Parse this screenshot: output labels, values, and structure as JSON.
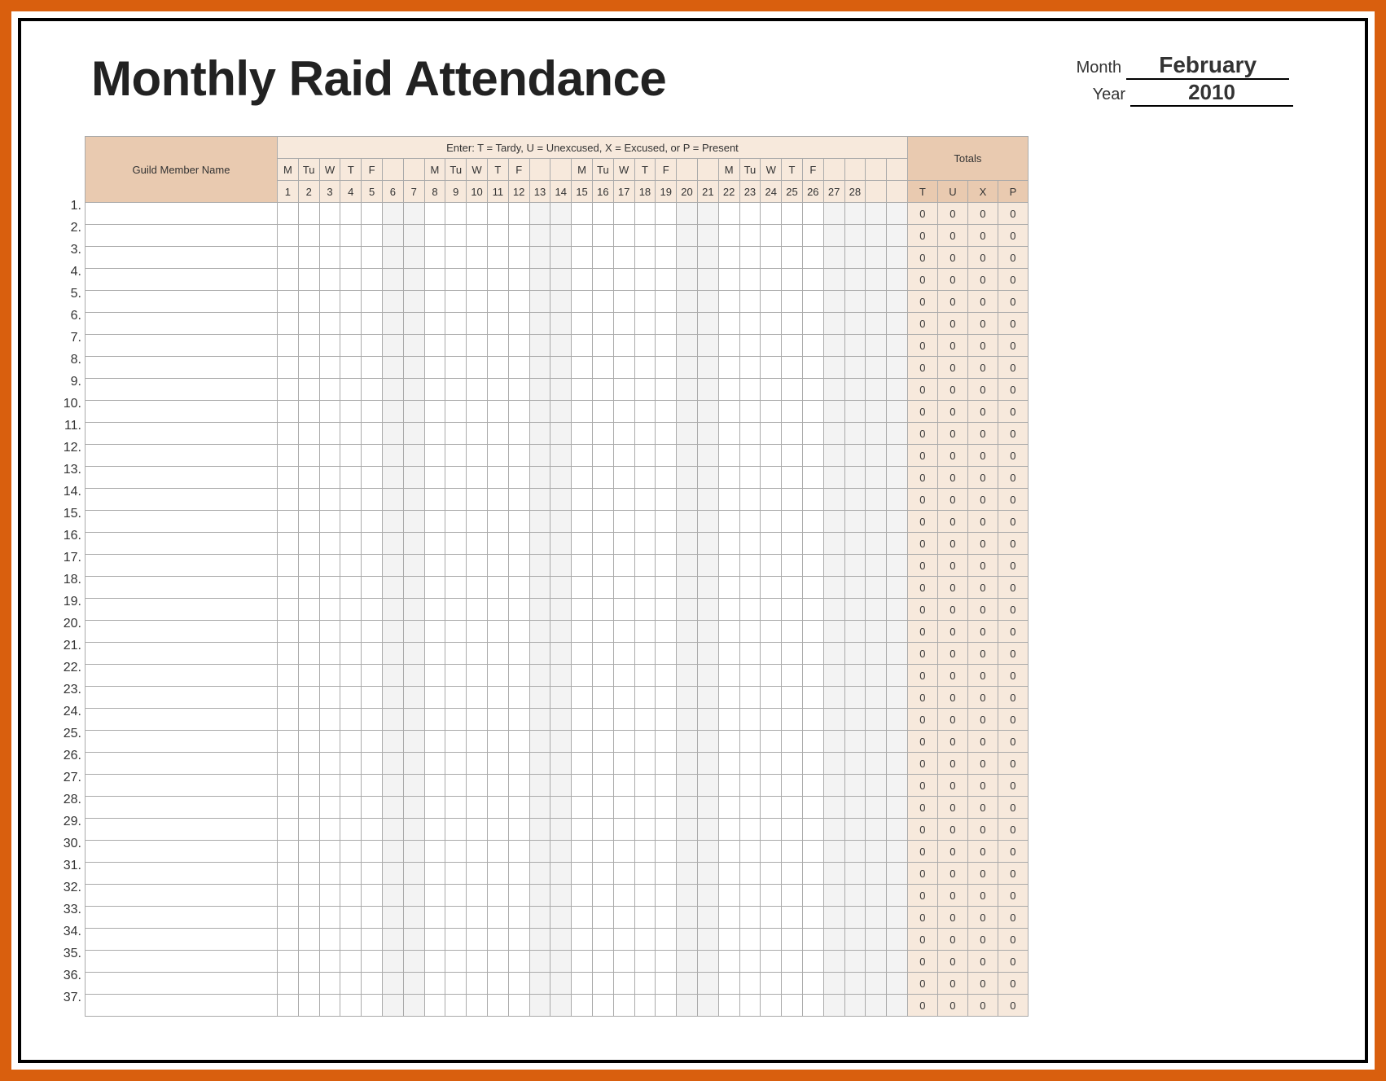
{
  "title": "Monthly Raid Attendance",
  "month_label": "Month",
  "year_label": "Year",
  "month_value": "February",
  "year_value": "2010",
  "legend": "Enter:  T = Tardy,   U = Unexcused,   X = Excused,   or P = Present",
  "name_header": "Guild Member Name",
  "totals_header": "Totals",
  "totals_cols": [
    "T",
    "U",
    "X",
    "P"
  ],
  "days": [
    {
      "n": 1,
      "dow": "M",
      "wk": false
    },
    {
      "n": 2,
      "dow": "Tu",
      "wk": false
    },
    {
      "n": 3,
      "dow": "W",
      "wk": false
    },
    {
      "n": 4,
      "dow": "T",
      "wk": false
    },
    {
      "n": 5,
      "dow": "F",
      "wk": false
    },
    {
      "n": 6,
      "dow": "",
      "wk": true
    },
    {
      "n": 7,
      "dow": "",
      "wk": true
    },
    {
      "n": 8,
      "dow": "M",
      "wk": false
    },
    {
      "n": 9,
      "dow": "Tu",
      "wk": false
    },
    {
      "n": 10,
      "dow": "W",
      "wk": false
    },
    {
      "n": 11,
      "dow": "T",
      "wk": false
    },
    {
      "n": 12,
      "dow": "F",
      "wk": false
    },
    {
      "n": 13,
      "dow": "",
      "wk": true
    },
    {
      "n": 14,
      "dow": "",
      "wk": true
    },
    {
      "n": 15,
      "dow": "M",
      "wk": false
    },
    {
      "n": 16,
      "dow": "Tu",
      "wk": false
    },
    {
      "n": 17,
      "dow": "W",
      "wk": false
    },
    {
      "n": 18,
      "dow": "T",
      "wk": false
    },
    {
      "n": 19,
      "dow": "F",
      "wk": false
    },
    {
      "n": 20,
      "dow": "",
      "wk": true
    },
    {
      "n": 21,
      "dow": "",
      "wk": true
    },
    {
      "n": 22,
      "dow": "M",
      "wk": false
    },
    {
      "n": 23,
      "dow": "Tu",
      "wk": false
    },
    {
      "n": 24,
      "dow": "W",
      "wk": false
    },
    {
      "n": 25,
      "dow": "T",
      "wk": false
    },
    {
      "n": 26,
      "dow": "F",
      "wk": false
    },
    {
      "n": 27,
      "dow": "",
      "wk": true
    },
    {
      "n": 28,
      "dow": "",
      "wk": true
    },
    {
      "n": "",
      "dow": "",
      "wk": true
    },
    {
      "n": "",
      "dow": "",
      "wk": true
    }
  ],
  "row_count": 37,
  "totals_default": [
    "0",
    "0",
    "0",
    "0"
  ]
}
